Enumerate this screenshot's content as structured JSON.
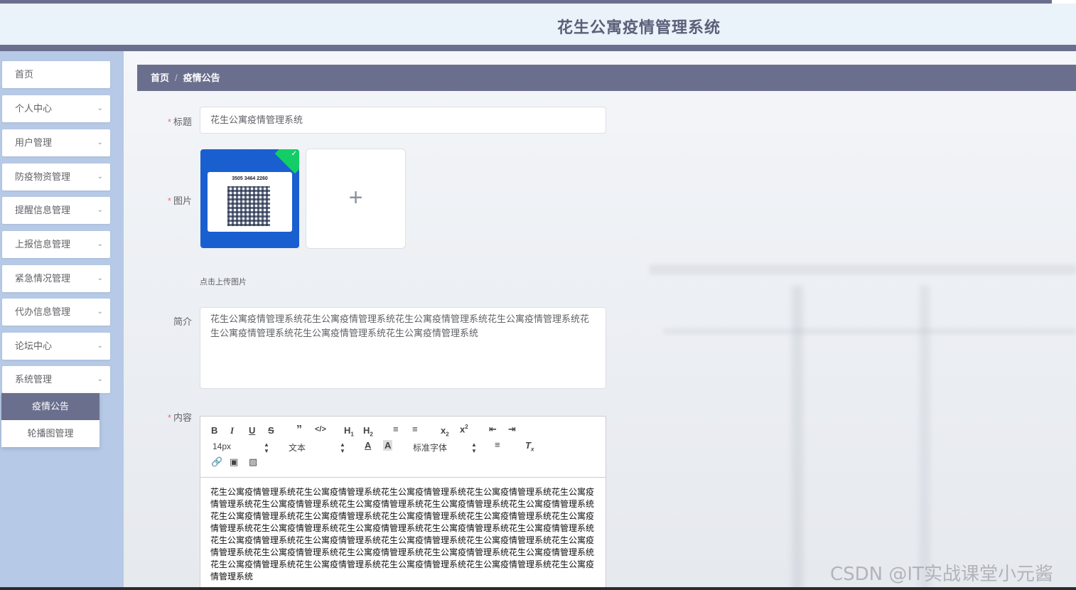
{
  "header": {
    "title": "花生公寓疫情管理系统"
  },
  "sidebar": {
    "items": [
      {
        "label": "首页"
      },
      {
        "label": "个人中心"
      },
      {
        "label": "用户管理"
      },
      {
        "label": "防疫物资管理"
      },
      {
        "label": "提醒信息管理"
      },
      {
        "label": "上报信息管理"
      },
      {
        "label": "紧急情况管理"
      },
      {
        "label": "代办信息管理"
      },
      {
        "label": "论坛中心"
      },
      {
        "label": "系统管理"
      }
    ],
    "submenu": [
      {
        "label": "疫情公告",
        "active": true
      },
      {
        "label": "轮播图管理",
        "active": false
      }
    ]
  },
  "breadcrumb": {
    "home": "首页",
    "sep": "/",
    "current": "疫情公告"
  },
  "form": {
    "title_label": "标题",
    "title_value": "花生公寓疫情管理系统",
    "image_label": "图片",
    "image_code": "3505 3464 2260",
    "upload_hint": "点击上传图片",
    "intro_label": "简介",
    "intro_value": "花生公寓疫情管理系统花生公寓疫情管理系统花生公寓疫情管理系统花生公寓疫情管理系统花生公寓疫情管理系统花生公寓疫情管理系统花生公寓疫情管理系统",
    "content_label": "内容",
    "required_mark": "*"
  },
  "editor": {
    "font_size": "14px",
    "block_format": "文本",
    "font_family": "标准字体",
    "content": "花生公寓疫情管理系统花生公寓疫情管理系统花生公寓疫情管理系统花生公寓疫情管理系统花生公寓疫情管理系统花生公寓疫情管理系统花生公寓疫情管理系统花生公寓疫情管理系统花生公寓疫情管理系统花生公寓疫情管理系统花生公寓疫情管理系统花生公寓疫情管理系统花生公寓疫情管理系统花生公寓疫情管理系统花生公寓疫情管理系统花生公寓疫情管理系统花生公寓疫情管理系统花生公寓疫情管理系统花生公寓疫情管理系统花生公寓疫情管理系统花生公寓疫情管理系统花生公寓疫情管理系统花生公寓疫情管理系统花生公寓疫情管理系统花生公寓疫情管理系统花生公寓疫情管理系统花生公寓疫情管理系统花生公寓疫情管理系统花生公寓疫情管理系统花生公寓疫情管理系统花生公寓疫情管理系统花生公寓疫情管理系统"
  },
  "watermark": "CSDN @IT实战课堂小元酱"
}
